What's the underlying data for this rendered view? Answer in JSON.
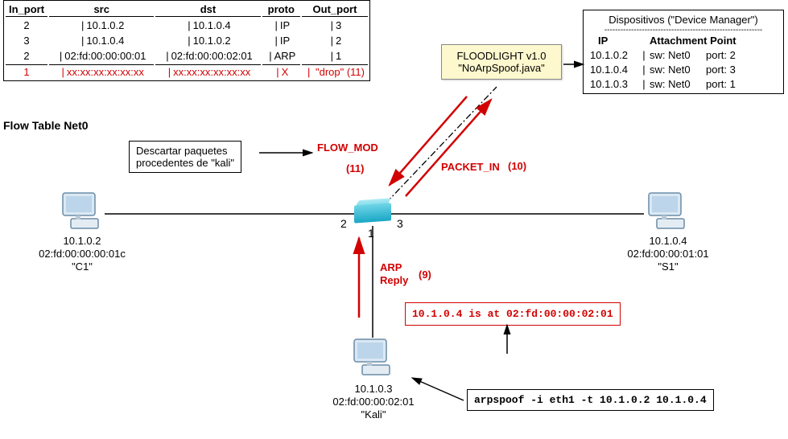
{
  "flow_table": {
    "caption": "Flow Table Net0",
    "headers": {
      "in_port": "In_port",
      "src": "src",
      "dst": "dst",
      "proto": "proto",
      "out_port": "Out_port"
    },
    "rows": [
      {
        "in": "2",
        "src": "10.1.0.2",
        "dst": "10.1.0.4",
        "proto": "IP",
        "out": "3"
      },
      {
        "in": "3",
        "src": "10.1.0.4",
        "dst": "10.1.0.2",
        "proto": "IP",
        "out": "2"
      },
      {
        "in": "2",
        "src": "02:fd:00:00:00:01",
        "dst": "02:fd:00:00:02:01",
        "proto": "ARP",
        "out": "1"
      }
    ],
    "drop_row": {
      "in": "1",
      "src": "xx:xx:xx:xx:xx:xx",
      "dst": "xx:xx:xx:xx:xx:xx",
      "proto": "X",
      "out": "\"drop\" (11)"
    }
  },
  "devices": {
    "title": "Dispositivos (\"Device Manager\")",
    "head_ip": "IP",
    "head_ap": "Attachment Point",
    "rows": [
      {
        "ip": "10.1.0.2",
        "sw": "sw: Net0",
        "port": "port: 2"
      },
      {
        "ip": "10.1.0.4",
        "sw": "sw: Net0",
        "port": "port: 3"
      },
      {
        "ip": "10.1.0.3",
        "sw": "sw: Net0",
        "port": "port: 1"
      }
    ]
  },
  "controller": {
    "line1": "FLOODLIGHT v1.0",
    "line2": "\"NoArpSpoof.java\""
  },
  "hint": {
    "line1": "Descartar paquetes",
    "line2": "procedentes de \"kali\""
  },
  "messages": {
    "flow_mod": "FLOW_MOD",
    "flow_mod_num": "(11)",
    "packet_in": "PACKET_IN",
    "packet_in_num": "(10)",
    "arp_reply_l1": "ARP",
    "arp_reply_l2": "Reply",
    "arp_reply_num": "(9)"
  },
  "arp_box": "10.1.0.4 is at 02:fd:00:00:02:01",
  "cmd_box": "arpspoof -i eth1 -t 10.1.0.2 10.1.0.4",
  "ports": {
    "p1": "1",
    "p2": "2",
    "p3": "3"
  },
  "hosts": {
    "c1": {
      "ip": "10.1.0.2",
      "mac": "02:fd:00:00:00:01c",
      "name": "\"C1\""
    },
    "s1": {
      "ip": "10.1.0.4",
      "mac": "02:fd:00:00:01:01",
      "name": "\"S1\""
    },
    "kali": {
      "ip": "10.1.0.3",
      "mac": "02:fd:00:00:02:01",
      "name": "\"Kali\""
    }
  }
}
